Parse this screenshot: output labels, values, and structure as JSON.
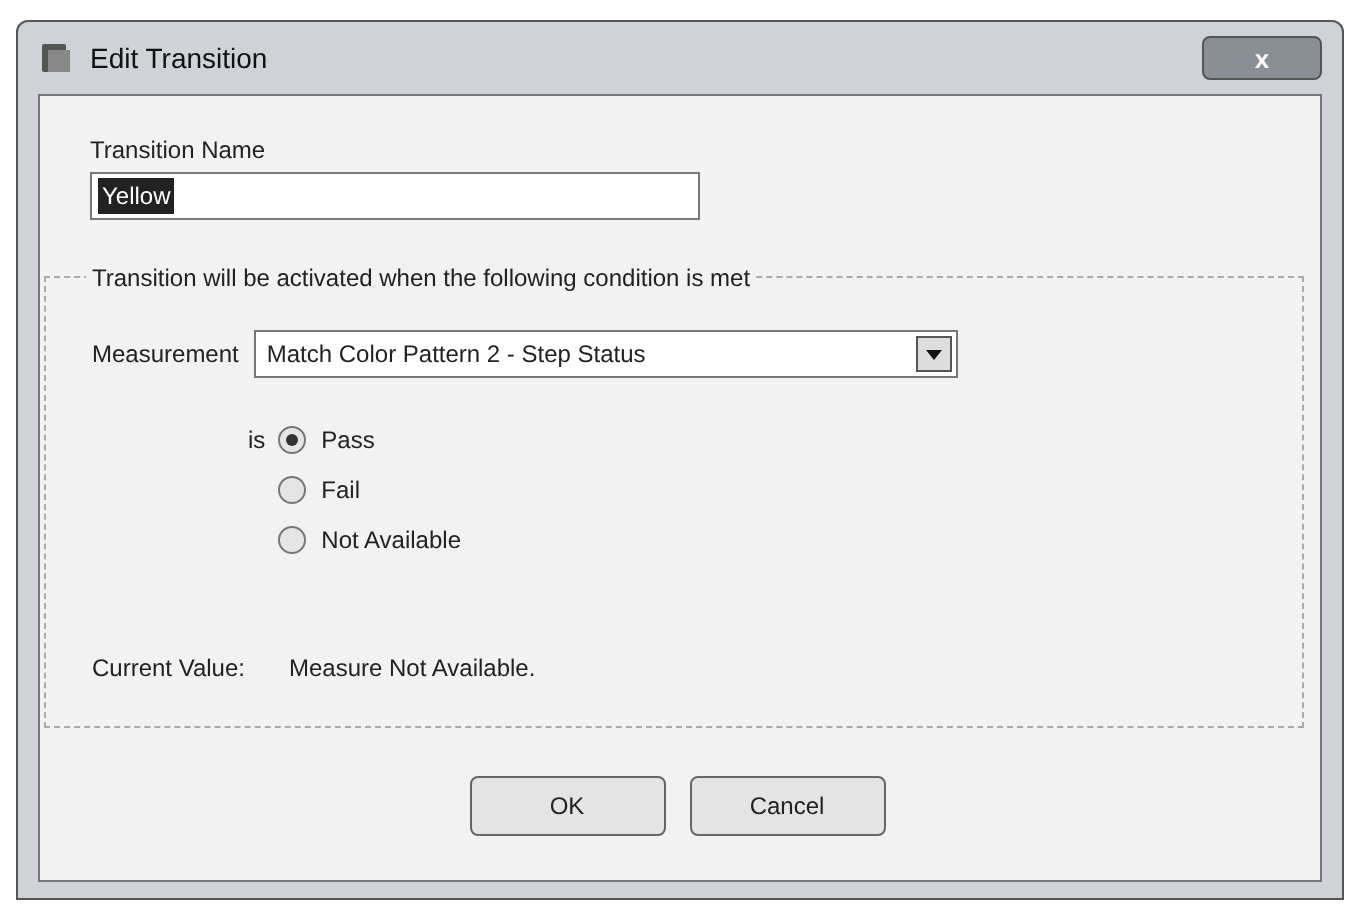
{
  "window": {
    "title": "Edit Transition",
    "close": "x"
  },
  "name_field": {
    "label": "Transition Name",
    "value": "Yellow",
    "text_selected": true
  },
  "condition": {
    "legend": "Transition will be activated when the following condition is met",
    "measurement": {
      "label": "Measurement",
      "value": "Match Color Pattern 2 - Step Status"
    },
    "is_label": "is",
    "options": [
      {
        "label": "Pass",
        "selected": true
      },
      {
        "label": "Fail",
        "selected": false
      },
      {
        "label": "Not Available",
        "selected": false
      }
    ],
    "current_value": {
      "label": "Current Value:",
      "value": "Measure Not Available."
    }
  },
  "buttons": [
    {
      "label": "OK"
    },
    {
      "label": "Cancel"
    }
  ]
}
